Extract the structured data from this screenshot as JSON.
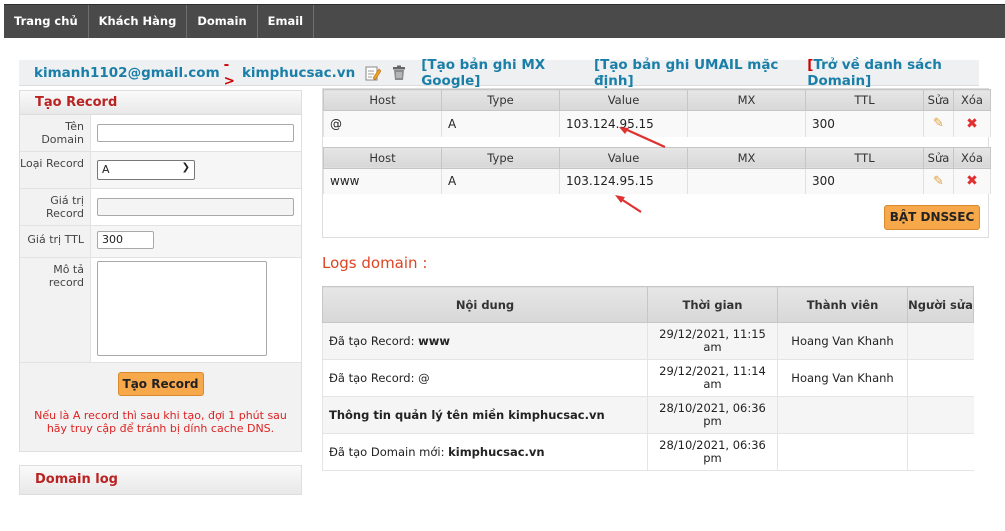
{
  "nav": [
    "Trang chủ",
    "Khách Hàng",
    "Domain",
    "Email"
  ],
  "domainbar": {
    "email": "kimanh1102@gmail.com",
    "arrow": "->",
    "domain": "kimphucsac.vn",
    "link_mx": "[Tạo bản ghi MX Google]",
    "link_umail": "[Tạo bản ghi UMAIL mặc định]",
    "back_bracket": "[",
    "back_text": "Trở về danh sách Domain]"
  },
  "form": {
    "title": "Tạo Record",
    "label_domain": "Tên Domain",
    "label_type": "Loại Record",
    "type_value": "A",
    "label_value": "Giá trị Record",
    "label_ttl": "Giá trị TTL",
    "ttl_value": "300",
    "label_desc": "Mô tả record",
    "submit": "Tạo Record",
    "note": "Nếu là A record thì sau khi tạo, đợi 1 phút sau hãy truy cập để tránh bị dính cache DNS."
  },
  "domainlog": "Domain log",
  "records_headers": [
    "Host",
    "Type",
    "Value",
    "MX",
    "TTL",
    "Sửa",
    "Xóa"
  ],
  "records": [
    {
      "host": "@",
      "type": "A",
      "value": "103.124.95.15",
      "mx": "",
      "ttl": "300"
    },
    {
      "host": "www",
      "type": "A",
      "value": "103.124.95.15",
      "mx": "",
      "ttl": "300"
    }
  ],
  "dnssec_button": "BẬT DNSSEC",
  "logs_title": "Logs domain :",
  "logs_headers": [
    "Nội dung",
    "Thời gian",
    "Thành viên",
    "Người sửa"
  ],
  "logs": [
    {
      "prefix": "Đã tạo Record: ",
      "bold": "www",
      "time1": "29/12/2021, 11:15",
      "time2": "am",
      "member": "Hoang Van Khanh"
    },
    {
      "prefix": "Đã tạo Record: @",
      "bold": "",
      "time1": "29/12/2021, 11:14",
      "time2": "am",
      "member": "Hoang Van Khanh"
    },
    {
      "prefix": "",
      "bold": "Thông tin quản lý tên miền kimphucsac.vn",
      "time1": "28/10/2021, 06:36",
      "time2": "pm",
      "member": ""
    },
    {
      "prefix": "Đã tạo Domain mới: ",
      "bold": "kimphucsac.vn",
      "time1": "28/10/2021, 06:36",
      "time2": "pm",
      "member": ""
    }
  ]
}
